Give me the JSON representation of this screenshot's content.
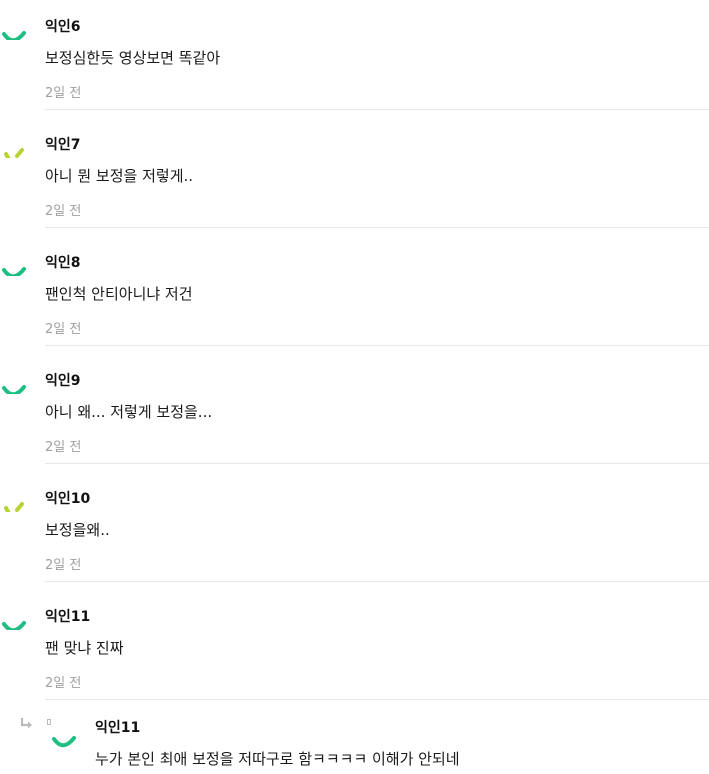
{
  "colors": {
    "avatar_green": "#1fbf84",
    "avatar_lime": "#b5d433",
    "time_gray": "#a0a0a0",
    "divider": "#e8e8e8"
  },
  "comments": [
    {
      "name": "익인6",
      "text": "보정심한듯 영상보면 똑같아",
      "time": "2일 전",
      "avatar": "green-arc"
    },
    {
      "name": "익인7",
      "text": "아니 뭔 보정을 저렇게..",
      "time": "2일 전",
      "avatar": "lime-dashes"
    },
    {
      "name": "익인8",
      "text": "팬인척 안티아니냐 저건",
      "time": "2일 전",
      "avatar": "green-arc"
    },
    {
      "name": "익인9",
      "text": "아니 왜... 저렇게 보정을...",
      "time": "2일 전",
      "avatar": "green-arc"
    },
    {
      "name": "익인10",
      "text": "보정을왜..",
      "time": "2일 전",
      "avatar": "lime-dashes"
    },
    {
      "name": "익인11",
      "text": "팬 맞냐 진짜",
      "time": "2일 전",
      "avatar": "green-arc"
    }
  ],
  "reply": {
    "name": "익인11",
    "text": "누가 본인 최애 보정을 저따구로 함ㅋㅋㅋㅋ 이해가 안되네",
    "icon": "reply-arrow-icon",
    "avatar": "green-arc"
  }
}
